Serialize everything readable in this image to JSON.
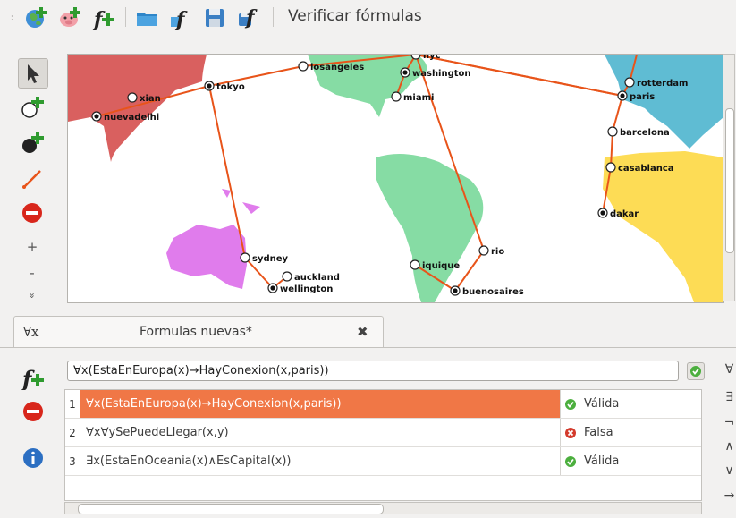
{
  "toolbar": {
    "verify_label": "Verificar fórmulas",
    "icons": [
      "add-world-icon",
      "add-pig-icon",
      "add-formula-icon",
      "open-folder-icon",
      "open-formula-icon",
      "save-icon",
      "save-formula-icon"
    ]
  },
  "map_tools": {
    "icons": [
      "pointer-icon",
      "add-node-icon",
      "add-black-node-icon",
      "add-edge-icon",
      "delete-icon"
    ],
    "zoom_in": "+",
    "zoom_out": "-",
    "more": "»"
  },
  "map": {
    "cities": [
      {
        "id": "xian",
        "label": "xian",
        "filled": false
      },
      {
        "id": "nuevadelhi",
        "label": "nuevadelhi",
        "filled": true
      },
      {
        "id": "tokyo",
        "label": "tokyo",
        "filled": true
      },
      {
        "id": "losangeles",
        "label": "losangeles",
        "filled": false
      },
      {
        "id": "nyc",
        "label": "nyc",
        "filled": false
      },
      {
        "id": "washington",
        "label": "washington",
        "filled": true
      },
      {
        "id": "miami",
        "label": "miami",
        "filled": false
      },
      {
        "id": "rotterdam",
        "label": "rotterdam",
        "filled": false
      },
      {
        "id": "paris",
        "label": "paris",
        "filled": true
      },
      {
        "id": "barcelona",
        "label": "barcelona",
        "filled": false
      },
      {
        "id": "casablanca",
        "label": "casablanca",
        "filled": false
      },
      {
        "id": "dakar",
        "label": "dakar",
        "filled": true
      },
      {
        "id": "rio",
        "label": "rio",
        "filled": false
      },
      {
        "id": "iquique",
        "label": "iquique",
        "filled": false
      },
      {
        "id": "buenosaires",
        "label": "buenosaires",
        "filled": true
      },
      {
        "id": "sydney",
        "label": "sydney",
        "filled": false
      },
      {
        "id": "auckland",
        "label": "auckland",
        "filled": false
      },
      {
        "id": "wellington",
        "label": "wellington",
        "filled": true
      }
    ],
    "edge_color": "#e8541a",
    "continent_colors": {
      "asia": "#d9605f",
      "americas": "#86dca4",
      "europe": "#5fbcd3",
      "africa": "#fddc55",
      "oceania": "#e07cec"
    }
  },
  "tab": {
    "symbol": "∀x",
    "title": "Formulas nuevas*",
    "close": "✖"
  },
  "formula_tools": {
    "icons": [
      "add-formula-icon",
      "delete-icon",
      "info-icon"
    ]
  },
  "formula_input": {
    "value": "∀x(EstaEnEuropa(x)→HayConexion(x,paris))"
  },
  "formulas": [
    {
      "num": "1",
      "formula": "∀x(EstaEnEuropa(x)→HayConexion(x,paris))",
      "result": "Válida",
      "valid": true
    },
    {
      "num": "2",
      "formula": "∀x∀ySePuedeLlegar(x,y)",
      "result": "Falsa",
      "valid": false
    },
    {
      "num": "3",
      "formula": "∃x(EstaEnOceania(x)∧EsCapital(x))",
      "result": "Válida",
      "valid": true
    }
  ],
  "symbols": [
    "∀",
    "∃",
    "¬",
    "∧",
    "∨",
    "→"
  ],
  "colors": {
    "selection": "#f07746",
    "valid": "#4caf3e",
    "invalid": "#d33a2c",
    "accent_green": "#3aa53a"
  }
}
